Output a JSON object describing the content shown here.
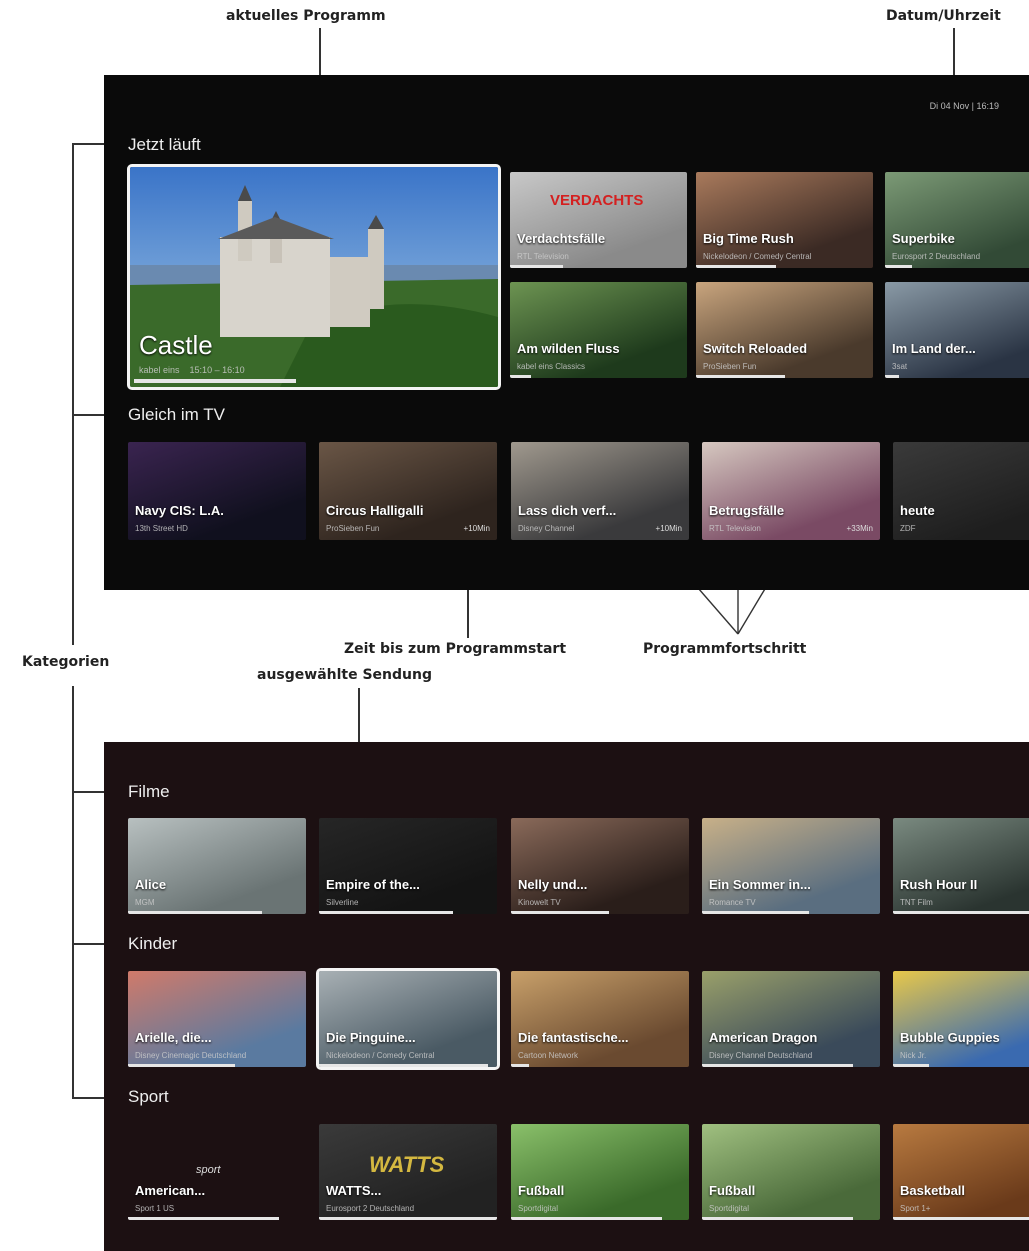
{
  "annotations": {
    "current_program": "aktuelles Programm",
    "datetime": "Datum/Uhrzeit",
    "categories": "Kategorien",
    "time_to_start": "Zeit bis zum Programmstart",
    "progress": "Programmfortschritt",
    "selected": "ausgewählte Sendung"
  },
  "screen1": {
    "datetime": "Di 04 Nov | 16:19",
    "now_label": "Jetzt läuft",
    "soon_label": "Gleich im TV",
    "featured": {
      "title": "Castle",
      "channel": "kabel eins",
      "time": "15:10 – 16:10",
      "progress": 0.45
    },
    "now": [
      {
        "title": "Verdachtsfälle",
        "channel": "RTL Television",
        "progress": 0.3,
        "overlay": "VERDACHTS",
        "colors": [
          "#8a8a8a",
          "#c8c8c8"
        ]
      },
      {
        "title": "Big Time Rush",
        "channel": "Nickelodeon / Comedy Central",
        "progress": 0.45,
        "colors": [
          "#3b2a24",
          "#a97a5c"
        ]
      },
      {
        "title": "Superbike",
        "channel": "Eurosport 2 Deutschland",
        "progress": 0.15,
        "colors": [
          "#324a36",
          "#7c9a76"
        ]
      },
      {
        "title": "Am wilden Fluss",
        "channel": "kabel eins Classics",
        "progress": 0.12,
        "colors": [
          "#1e3a1c",
          "#6d9452"
        ]
      },
      {
        "title": "Switch Reloaded",
        "channel": "ProSieben Fun",
        "progress": 0.5,
        "colors": [
          "#4a3a2c",
          "#c9a57e"
        ]
      },
      {
        "title": "Im Land der...",
        "channel": "3sat",
        "progress": 0.08,
        "colors": [
          "#2a3444",
          "#8a9aa6"
        ]
      }
    ],
    "soon": [
      {
        "title": "Navy CIS: L.A.",
        "channel": "13th Street HD",
        "mins": "",
        "colors": [
          "#10101e",
          "#3a2450"
        ]
      },
      {
        "title": "Circus Halligalli",
        "channel": "ProSieben Fun",
        "mins": "+10Min",
        "colors": [
          "#2e241e",
          "#6a5646"
        ]
      },
      {
        "title": "Lass dich verf...",
        "channel": "Disney Channel",
        "mins": "+10Min",
        "colors": [
          "#3a3a3c",
          "#a0998e"
        ]
      },
      {
        "title": "Betrugsfälle",
        "channel": "RTL Television",
        "mins": "+33Min",
        "colors": [
          "#7a4a64",
          "#d6c8c0"
        ]
      },
      {
        "title": "heute",
        "channel": "ZDF",
        "mins": "",
        "colors": [
          "#1e1e1e",
          "#3a3a3a"
        ]
      }
    ]
  },
  "screen2": {
    "filme_label": "Filme",
    "kinder_label": "Kinder",
    "sport_label": "Sport",
    "filme": [
      {
        "title": "Alice",
        "channel": "MGM",
        "progress": 0.75,
        "colors": [
          "#6a7474",
          "#b8c0c0"
        ]
      },
      {
        "title": "Empire of the...",
        "channel": "Silverline",
        "progress": 0.75,
        "colors": [
          "#141414",
          "#262626"
        ]
      },
      {
        "title": "Nelly und...",
        "channel": "Kinowelt TV",
        "progress": 0.55,
        "colors": [
          "#2a1e1a",
          "#8a6a5a"
        ]
      },
      {
        "title": "Ein Sommer in...",
        "channel": "Romance TV",
        "progress": 0.6,
        "colors": [
          "#5a6e80",
          "#c8b088"
        ]
      },
      {
        "title": "Rush Hour II",
        "channel": "TNT Film",
        "progress": 0.85,
        "colors": [
          "#2a3430",
          "#7a8a80"
        ]
      }
    ],
    "kinder": [
      {
        "title": "Arielle, die...",
        "channel": "Disney Cinemagic Deutschland",
        "progress": 0.6,
        "colors": [
          "#5a7aa0",
          "#d07a6a"
        ]
      },
      {
        "title": "Die Pinguine...",
        "channel": "Nickelodeon / Comedy Central",
        "progress": 0.95,
        "colors": [
          "#4a5a64",
          "#a8b0b4"
        ]
      },
      {
        "title": "Die fantastische...",
        "channel": "Cartoon Network",
        "progress": 0.1,
        "colors": [
          "#6a4a30",
          "#c8a06a"
        ]
      },
      {
        "title": "American Dragon",
        "channel": "Disney Channel Deutschland",
        "progress": 0.85,
        "colors": [
          "#3a4a5a",
          "#9aa06a"
        ]
      },
      {
        "title": "Bubble Guppies",
        "channel": "Nick Jr.",
        "progress": 0.2,
        "colors": [
          "#3a6ab0",
          "#e8c84a"
        ]
      }
    ],
    "sport": [
      {
        "title": "American...",
        "channel": "Sport 1 US",
        "progress": 0.85,
        "logo": "sport",
        "colors": [
          "#1c1012",
          "#1c1012"
        ]
      },
      {
        "title": "WATTS...",
        "channel": "Eurosport 2 Deutschland",
        "progress": 1.0,
        "logo": "WATTS",
        "colors": [
          "#222222",
          "#3a3a3a"
        ]
      },
      {
        "title": "Fußball",
        "channel": "Sportdigital",
        "progress": 0.85,
        "colors": [
          "#3a6a2a",
          "#8ac06a"
        ]
      },
      {
        "title": "Fußball",
        "channel": "Sportdigital",
        "progress": 0.85,
        "colors": [
          "#4a6a3a",
          "#a0c080"
        ]
      },
      {
        "title": "Basketball",
        "channel": "Sport 1+",
        "progress": 0.85,
        "colors": [
          "#6a3a1a",
          "#b87a40"
        ]
      }
    ]
  }
}
